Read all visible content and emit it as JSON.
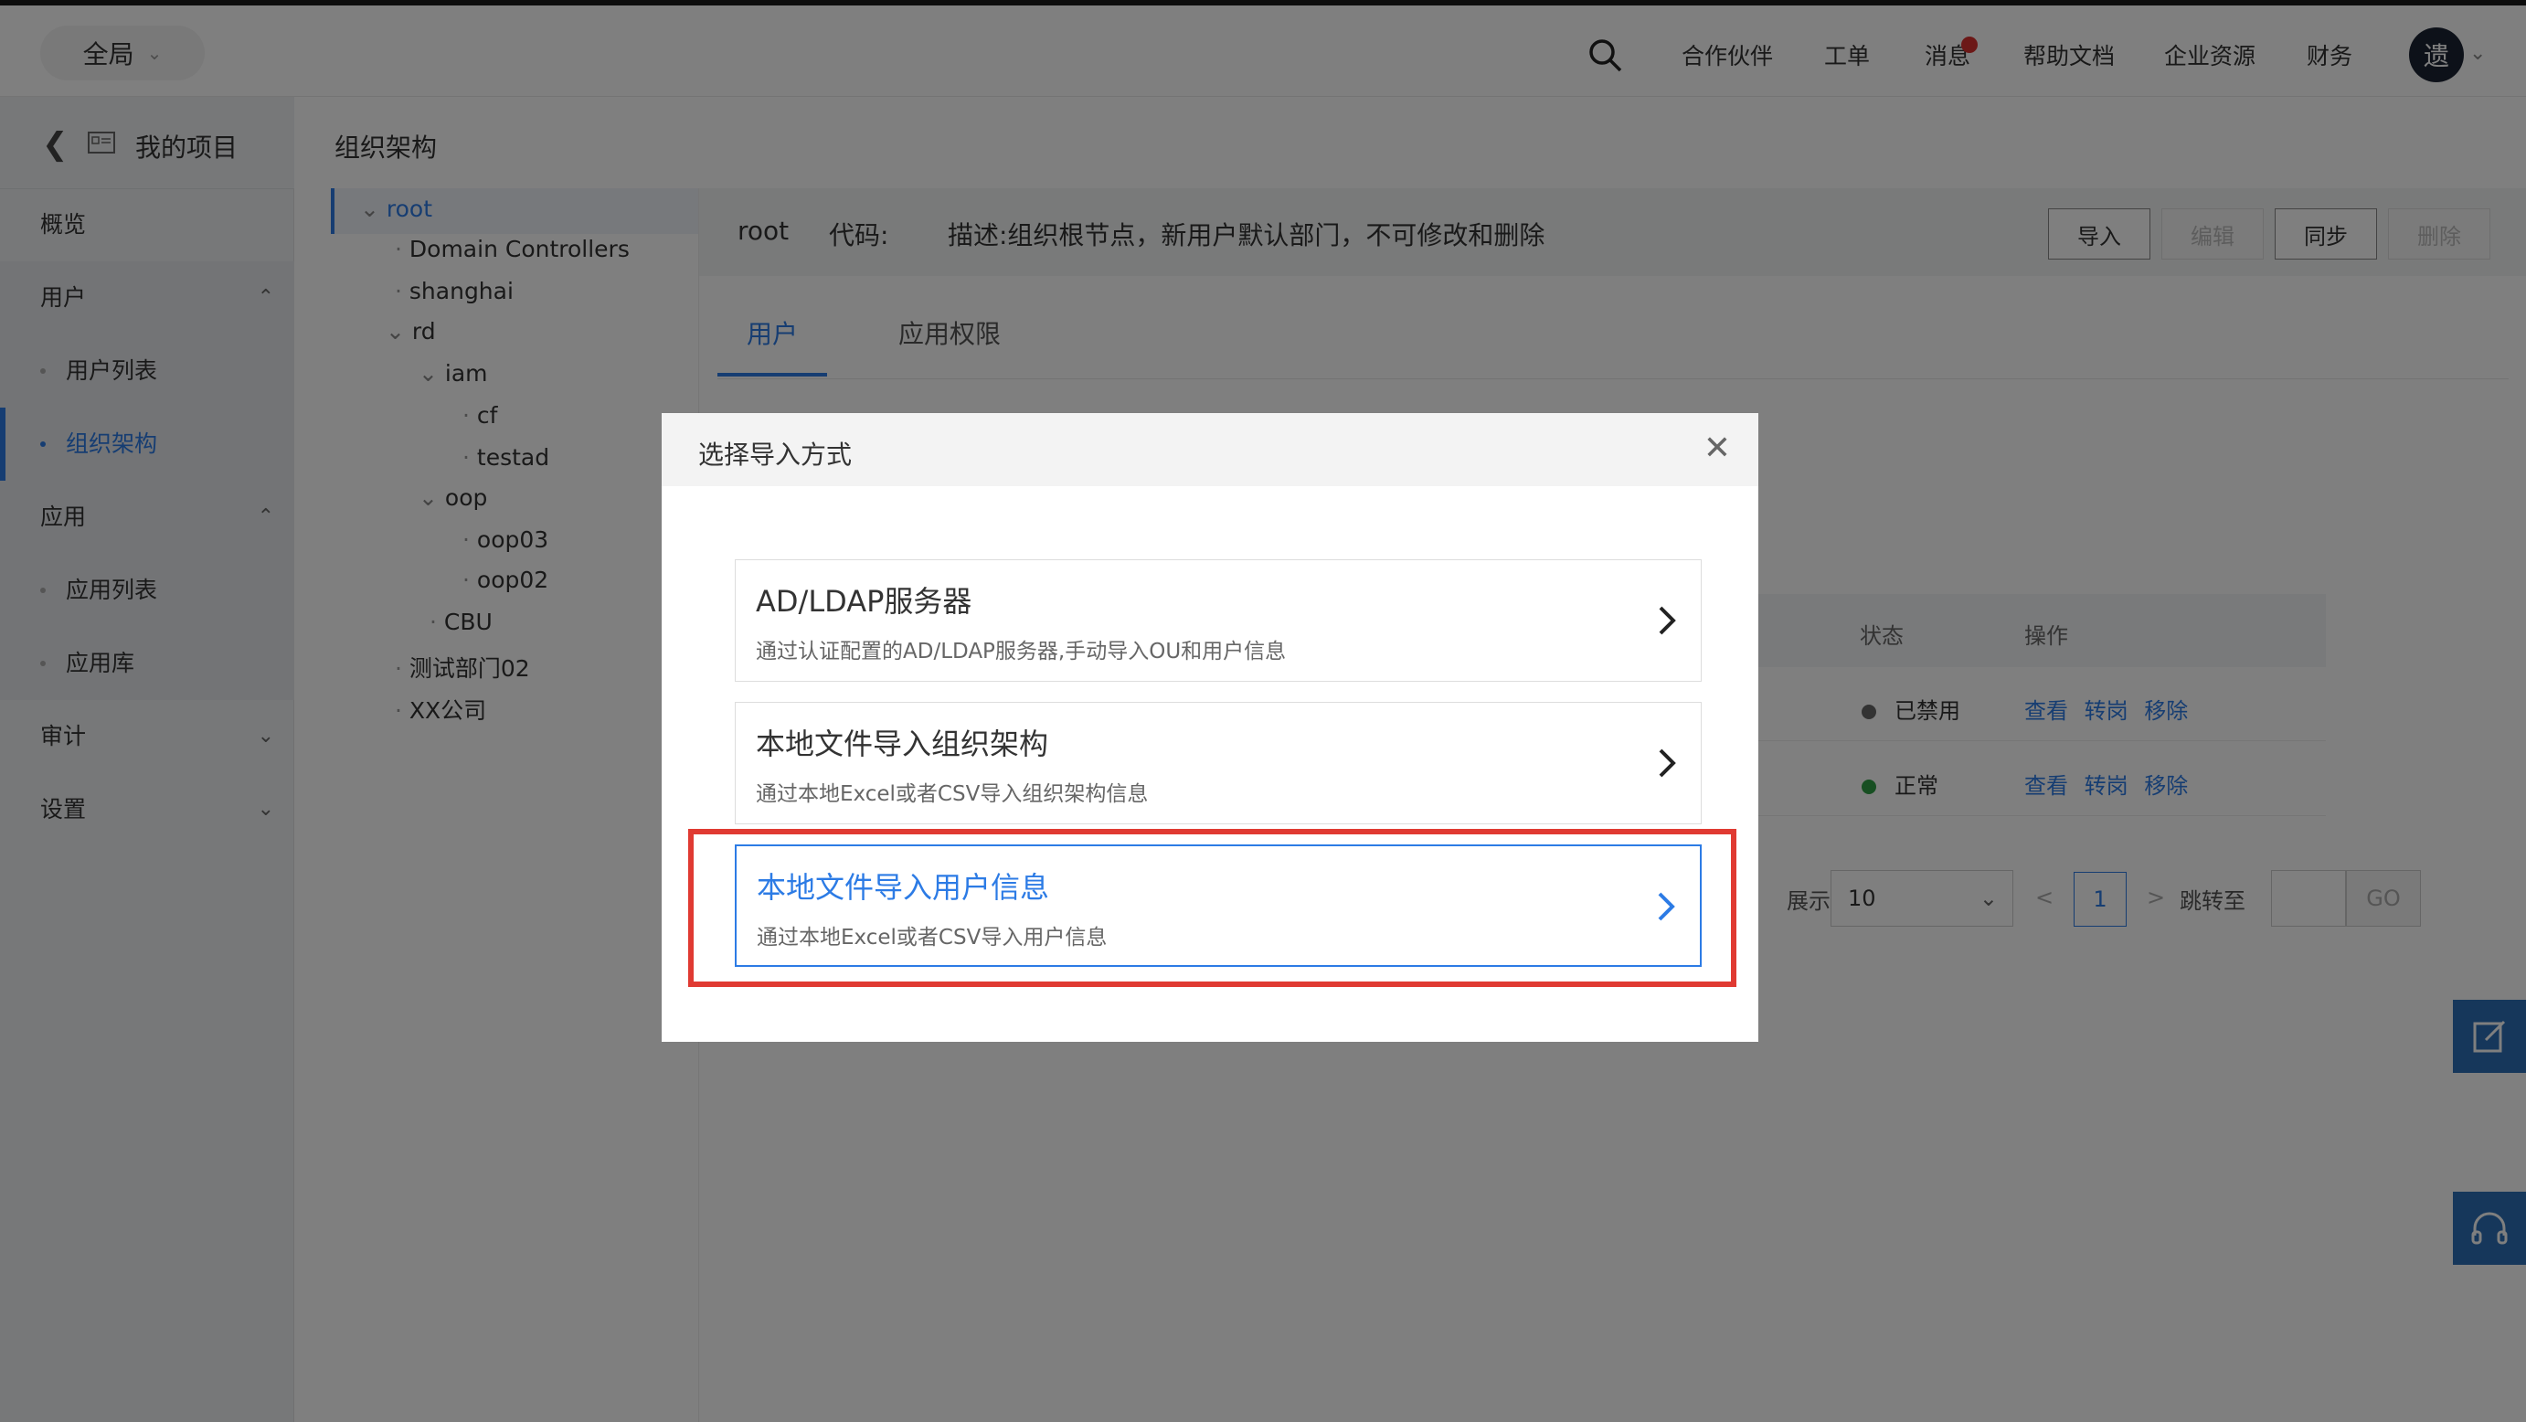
{
  "topbar": {
    "scope_label": "全局",
    "nav": [
      "合作伙伴",
      "工单",
      "消息",
      "帮助文档",
      "企业资源",
      "财务"
    ],
    "avatar_char": "遗"
  },
  "sidebar": {
    "back_title": "我的项目",
    "items": [
      {
        "label": "概览"
      },
      {
        "label": "用户",
        "children": [
          "用户列表",
          "组织架构"
        ]
      },
      {
        "label": "应用",
        "children": [
          "应用列表",
          "应用库"
        ]
      },
      {
        "label": "审计"
      },
      {
        "label": "设置"
      }
    ],
    "active": "组织架构"
  },
  "main": {
    "page_title": "组织架构",
    "tree": [
      "root",
      "Domain Controllers",
      "shanghai",
      "rd",
      "iam",
      "cf",
      "testad",
      "oop",
      "oop03",
      "oop02",
      "CBU",
      "测试部门02",
      "XX公司"
    ],
    "detail": {
      "name": "root",
      "code_label": "代码:",
      "desc": "描述:组织根节点，新用户默认部门，不可修改和删除",
      "buttons": {
        "import": "导入",
        "edit": "编辑",
        "sync": "同步",
        "delete": "删除"
      },
      "tabs": [
        "用户",
        "应用权限"
      ],
      "table": {
        "headers": {
          "status": "状态",
          "ops": "操作"
        },
        "rows": [
          {
            "status": "已禁用",
            "status_color": "#666666",
            "ops": [
              "查看",
              "转岗",
              "移除"
            ]
          },
          {
            "status": "正常",
            "status_color": "#2e9e44",
            "ops": [
              "查看",
              "转岗",
              "移除"
            ]
          }
        ]
      },
      "pager": {
        "show_label": "展示",
        "page_size": "10",
        "prev": "<",
        "current": "1",
        "next": ">",
        "jump_label": "跳转至",
        "go": "GO"
      }
    }
  },
  "modal": {
    "title": "选择导入方式",
    "options": [
      {
        "title": "AD/LDAP服务器",
        "desc": "通过认证配置的AD/LDAP服务器,手动导入OU和用户信息"
      },
      {
        "title": "本地文件导入组织架构",
        "desc": "通过本地Excel或者CSV导入组织架构信息"
      },
      {
        "title": "本地文件导入用户信息",
        "desc": "通过本地Excel或者CSV导入用户信息"
      }
    ]
  },
  "colors": {
    "accent": "#2c7be5",
    "highlight": "#e03a32"
  }
}
